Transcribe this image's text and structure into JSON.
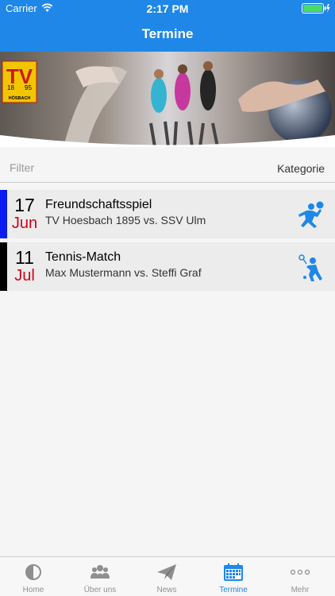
{
  "status_bar": {
    "carrier": "Carrier",
    "time": "2:17 PM"
  },
  "nav": {
    "title": "Termine"
  },
  "filter": {
    "placeholder": "Filter",
    "category_label": "Kategorie"
  },
  "events": [
    {
      "day": "17",
      "month": "Jun",
      "title": "Freundschaftsspiel",
      "subtitle": "TV Hoesbach 1895 vs. SSV Ulm",
      "category_color": "#0a1cf0",
      "icon": "handball-icon"
    },
    {
      "day": "11",
      "month": "Jul",
      "title": "Tennis-Match",
      "subtitle": "Max Mustermann vs. Steffi Graf",
      "category_color": "#000000",
      "icon": "tennis-icon"
    }
  ],
  "tabs": [
    {
      "label": "Home",
      "icon": "home-icon",
      "active": false
    },
    {
      "label": "Über uns",
      "icon": "group-icon",
      "active": false
    },
    {
      "label": "News",
      "icon": "paper-plane-icon",
      "active": false
    },
    {
      "label": "Termine",
      "icon": "calendar-icon",
      "active": true
    },
    {
      "label": "Mehr",
      "icon": "more-icon",
      "active": false
    }
  ],
  "colors": {
    "accent": "#1f87e8",
    "month_red": "#d0021b"
  },
  "banner": {
    "logo_letters": "TV",
    "logo_year_left": "18",
    "logo_year_right": "95",
    "logo_text": "HÖSBACH"
  }
}
